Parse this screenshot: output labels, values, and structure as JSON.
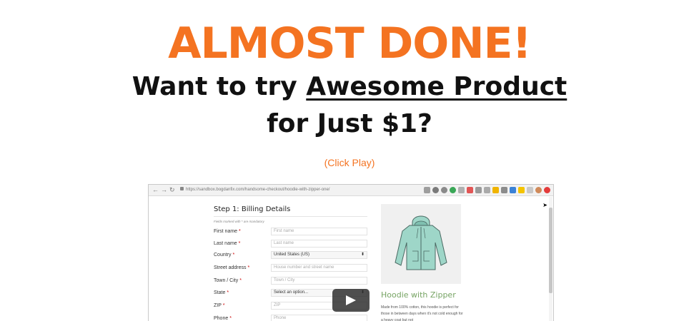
{
  "hero": {
    "headline": "ALMOST DONE!",
    "line1_prefix": "Want to try ",
    "line1_product": "Awesome Product",
    "line2": "for Just $1?",
    "cta_hint": "(Click Play)"
  },
  "video": {
    "browser": {
      "url": "https://sandbox.bogdanfix.com/handsome-checkout/hoodie-with-zipper-one/"
    },
    "checkout": {
      "step_title": "Step 1: Billing Details",
      "mandatory_note": "Fields marked with * are mandatory",
      "fields": [
        {
          "label": "First name",
          "required": "*",
          "placeholder": "First name",
          "type": "text"
        },
        {
          "label": "Last name",
          "required": "*",
          "placeholder": "Last name",
          "type": "text"
        },
        {
          "label": "Country",
          "required": "*",
          "value": "United States (US)",
          "type": "select"
        },
        {
          "label": "Street address",
          "required": "*",
          "placeholder": "House number and street name",
          "type": "text"
        },
        {
          "label": "Town / City",
          "required": "*",
          "placeholder": "Town / City",
          "type": "text"
        },
        {
          "label": "State",
          "required": "*",
          "value": "Select an option...",
          "type": "select"
        },
        {
          "label": "ZIP",
          "required": "*",
          "placeholder": "ZIP",
          "type": "text"
        },
        {
          "label": "Phone",
          "required": "*",
          "placeholder": "Phone",
          "type": "text"
        }
      ]
    },
    "product": {
      "name": "Hoodie with Zipper",
      "description": "Made from 100% cotton, this hoodie is perfect for those in between days when it's not cold enough for a heavy coat but not"
    }
  },
  "colors": {
    "accent": "#f47321",
    "product_name": "#77a464",
    "hoodie": "#9ed6c8"
  }
}
